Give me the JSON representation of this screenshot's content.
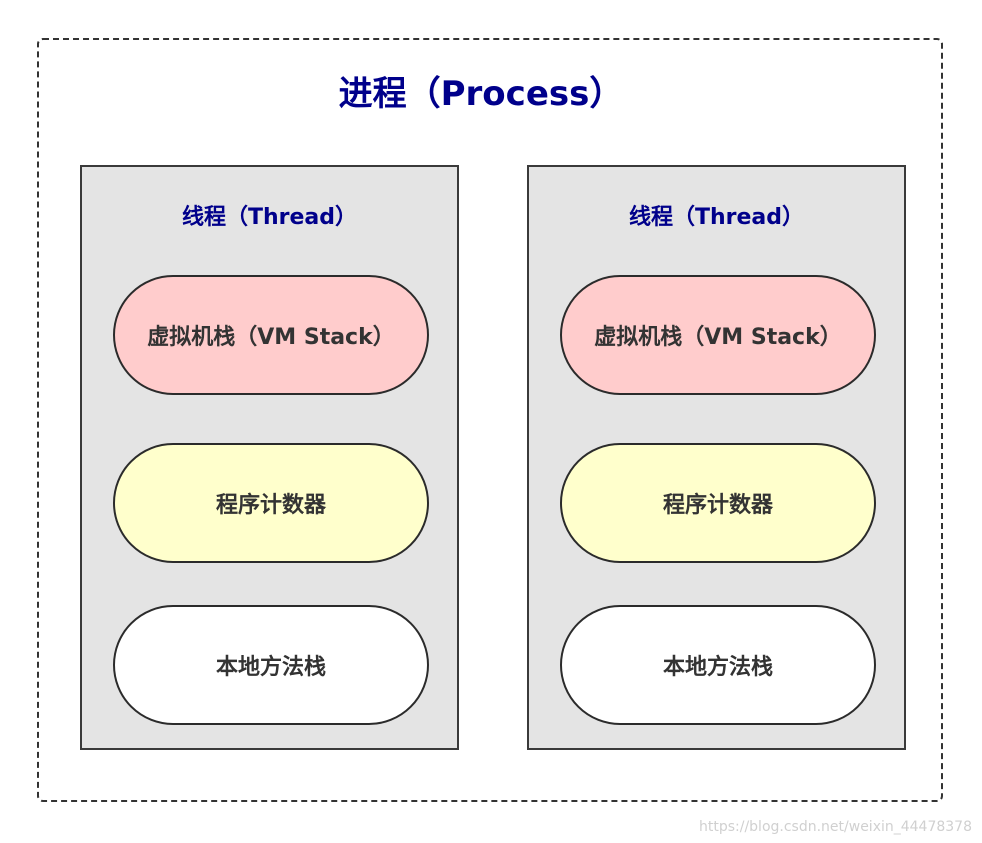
{
  "process": {
    "title": "进程（Process）"
  },
  "threads": [
    {
      "title": "线程（Thread）",
      "vm_stack": "虚拟机栈（VM Stack）",
      "program_counter": "程序计数器",
      "native_method_stack": "本地方法栈"
    },
    {
      "title": "线程（Thread）",
      "vm_stack": "虚拟机栈（VM Stack）",
      "program_counter": "程序计数器",
      "native_method_stack": "本地方法栈"
    }
  ],
  "colors": {
    "title_blue": "#00008b",
    "vm_stack_fill": "#ffcccc",
    "program_counter_fill": "#ffffcc",
    "native_method_stack_fill": "#ffffff",
    "thread_fill": "#e4e4e4"
  },
  "watermark": "https://blog.csdn.net/weixin_44478378"
}
